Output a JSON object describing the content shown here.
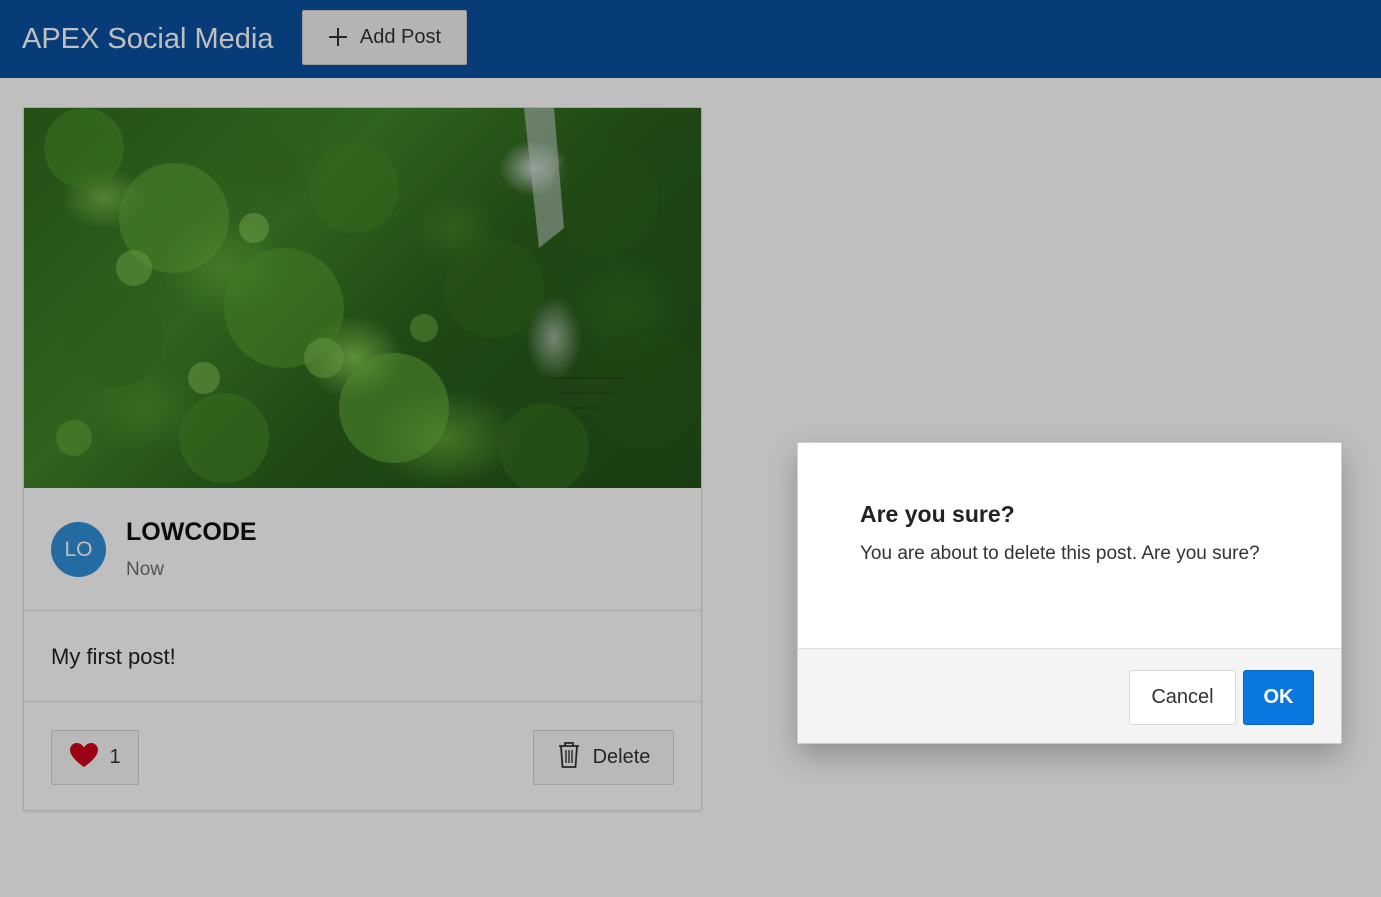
{
  "header": {
    "app_title": "APEX Social Media",
    "add_post_label": "Add Post",
    "add_post_icon": "plus-icon",
    "background_color": "#0a50a0"
  },
  "post": {
    "image_alt": "Green trees photo",
    "avatar_initials": "LO",
    "avatar_color": "#2f8fd6",
    "username": "LOWCODE",
    "timestamp": "Now",
    "text": "My first post!",
    "like_icon": "heart-icon",
    "like_count": "1",
    "delete_icon": "trash-icon",
    "delete_label": "Delete"
  },
  "dialog": {
    "title": "Are you sure?",
    "message": "You are about to delete this post. Are you sure?",
    "cancel_label": "Cancel",
    "ok_label": "OK",
    "ok_color": "#0a76e0"
  }
}
